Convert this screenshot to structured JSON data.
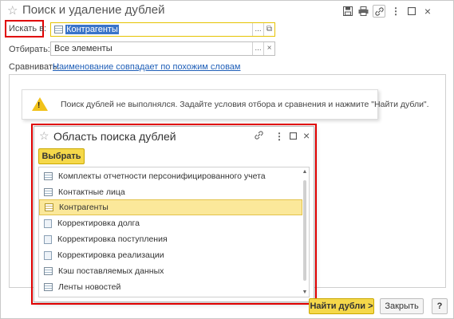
{
  "window": {
    "title": "Поиск и удаление дублей",
    "icons": [
      "save-icon",
      "print-icon",
      "link-icon",
      "more-icon",
      "maximize-icon",
      "close-icon"
    ]
  },
  "form": {
    "search_in_label": "Искать в:",
    "search_in_value": "Контрагенты",
    "filter_label": "Отбирать:",
    "filter_value": "Все элементы",
    "compare_label": "Сравнивать:",
    "compare_link": "Наименование совпадает по похожим словам"
  },
  "message": {
    "text": "Поиск дублей не выполнялся.  Задайте условия отбора и сравнения и нажмите \"Найти дубли\"."
  },
  "popup": {
    "title": "Область поиска дублей",
    "select_button": "Выбрать",
    "items": [
      {
        "label": "Комплекты отчетности персонифицированного учета",
        "icon": "table-icon",
        "selected": false
      },
      {
        "label": "Контактные лица",
        "icon": "table-icon",
        "selected": false
      },
      {
        "label": "Контрагенты",
        "icon": "table-icon",
        "selected": true
      },
      {
        "label": "Корректировка долга",
        "icon": "document-icon",
        "selected": false
      },
      {
        "label": "Корректировка поступления",
        "icon": "document-icon",
        "selected": false
      },
      {
        "label": "Корректировка реализации",
        "icon": "document-icon",
        "selected": false
      },
      {
        "label": "Кэш поставляемых данных",
        "icon": "table-icon",
        "selected": false
      },
      {
        "label": "Ленты новостей",
        "icon": "table-icon",
        "selected": false
      }
    ]
  },
  "footer": {
    "find_button": "Найти дубли >",
    "close_button": "Закрыть",
    "help_button": "?"
  },
  "colors": {
    "highlight_red": "#e00000",
    "accent_yellow": "#f5d84a",
    "link_blue": "#1f5fb8",
    "selection_blue": "#3a74c9"
  }
}
